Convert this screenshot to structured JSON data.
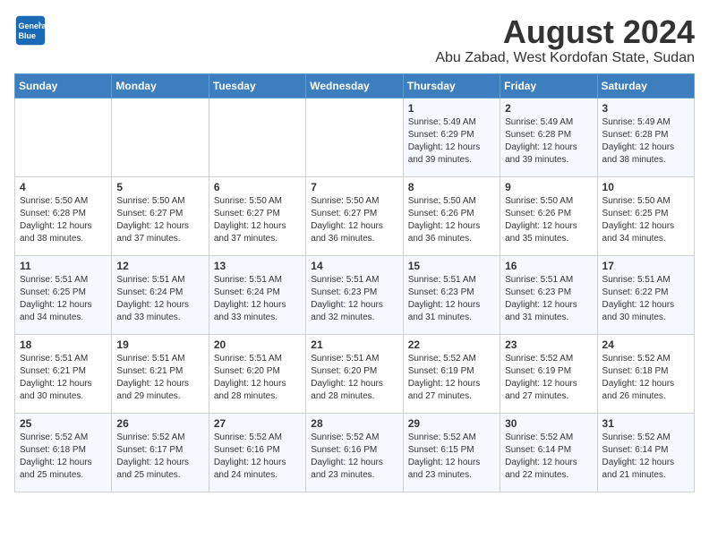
{
  "logo": {
    "line1": "General",
    "line2": "Blue"
  },
  "title": "August 2024",
  "subtitle": "Abu Zabad, West Kordofan State, Sudan",
  "days_of_week": [
    "Sunday",
    "Monday",
    "Tuesday",
    "Wednesday",
    "Thursday",
    "Friday",
    "Saturday"
  ],
  "weeks": [
    [
      {
        "day": "",
        "info": ""
      },
      {
        "day": "",
        "info": ""
      },
      {
        "day": "",
        "info": ""
      },
      {
        "day": "",
        "info": ""
      },
      {
        "day": "1",
        "info": "Sunrise: 5:49 AM\nSunset: 6:29 PM\nDaylight: 12 hours\nand 39 minutes."
      },
      {
        "day": "2",
        "info": "Sunrise: 5:49 AM\nSunset: 6:28 PM\nDaylight: 12 hours\nand 39 minutes."
      },
      {
        "day": "3",
        "info": "Sunrise: 5:49 AM\nSunset: 6:28 PM\nDaylight: 12 hours\nand 38 minutes."
      }
    ],
    [
      {
        "day": "4",
        "info": "Sunrise: 5:50 AM\nSunset: 6:28 PM\nDaylight: 12 hours\nand 38 minutes."
      },
      {
        "day": "5",
        "info": "Sunrise: 5:50 AM\nSunset: 6:27 PM\nDaylight: 12 hours\nand 37 minutes."
      },
      {
        "day": "6",
        "info": "Sunrise: 5:50 AM\nSunset: 6:27 PM\nDaylight: 12 hours\nand 37 minutes."
      },
      {
        "day": "7",
        "info": "Sunrise: 5:50 AM\nSunset: 6:27 PM\nDaylight: 12 hours\nand 36 minutes."
      },
      {
        "day": "8",
        "info": "Sunrise: 5:50 AM\nSunset: 6:26 PM\nDaylight: 12 hours\nand 36 minutes."
      },
      {
        "day": "9",
        "info": "Sunrise: 5:50 AM\nSunset: 6:26 PM\nDaylight: 12 hours\nand 35 minutes."
      },
      {
        "day": "10",
        "info": "Sunrise: 5:50 AM\nSunset: 6:25 PM\nDaylight: 12 hours\nand 34 minutes."
      }
    ],
    [
      {
        "day": "11",
        "info": "Sunrise: 5:51 AM\nSunset: 6:25 PM\nDaylight: 12 hours\nand 34 minutes."
      },
      {
        "day": "12",
        "info": "Sunrise: 5:51 AM\nSunset: 6:24 PM\nDaylight: 12 hours\nand 33 minutes."
      },
      {
        "day": "13",
        "info": "Sunrise: 5:51 AM\nSunset: 6:24 PM\nDaylight: 12 hours\nand 33 minutes."
      },
      {
        "day": "14",
        "info": "Sunrise: 5:51 AM\nSunset: 6:23 PM\nDaylight: 12 hours\nand 32 minutes."
      },
      {
        "day": "15",
        "info": "Sunrise: 5:51 AM\nSunset: 6:23 PM\nDaylight: 12 hours\nand 31 minutes."
      },
      {
        "day": "16",
        "info": "Sunrise: 5:51 AM\nSunset: 6:23 PM\nDaylight: 12 hours\nand 31 minutes."
      },
      {
        "day": "17",
        "info": "Sunrise: 5:51 AM\nSunset: 6:22 PM\nDaylight: 12 hours\nand 30 minutes."
      }
    ],
    [
      {
        "day": "18",
        "info": "Sunrise: 5:51 AM\nSunset: 6:21 PM\nDaylight: 12 hours\nand 30 minutes."
      },
      {
        "day": "19",
        "info": "Sunrise: 5:51 AM\nSunset: 6:21 PM\nDaylight: 12 hours\nand 29 minutes."
      },
      {
        "day": "20",
        "info": "Sunrise: 5:51 AM\nSunset: 6:20 PM\nDaylight: 12 hours\nand 28 minutes."
      },
      {
        "day": "21",
        "info": "Sunrise: 5:51 AM\nSunset: 6:20 PM\nDaylight: 12 hours\nand 28 minutes."
      },
      {
        "day": "22",
        "info": "Sunrise: 5:52 AM\nSunset: 6:19 PM\nDaylight: 12 hours\nand 27 minutes."
      },
      {
        "day": "23",
        "info": "Sunrise: 5:52 AM\nSunset: 6:19 PM\nDaylight: 12 hours\nand 27 minutes."
      },
      {
        "day": "24",
        "info": "Sunrise: 5:52 AM\nSunset: 6:18 PM\nDaylight: 12 hours\nand 26 minutes."
      }
    ],
    [
      {
        "day": "25",
        "info": "Sunrise: 5:52 AM\nSunset: 6:18 PM\nDaylight: 12 hours\nand 25 minutes."
      },
      {
        "day": "26",
        "info": "Sunrise: 5:52 AM\nSunset: 6:17 PM\nDaylight: 12 hours\nand 25 minutes."
      },
      {
        "day": "27",
        "info": "Sunrise: 5:52 AM\nSunset: 6:16 PM\nDaylight: 12 hours\nand 24 minutes."
      },
      {
        "day": "28",
        "info": "Sunrise: 5:52 AM\nSunset: 6:16 PM\nDaylight: 12 hours\nand 23 minutes."
      },
      {
        "day": "29",
        "info": "Sunrise: 5:52 AM\nSunset: 6:15 PM\nDaylight: 12 hours\nand 23 minutes."
      },
      {
        "day": "30",
        "info": "Sunrise: 5:52 AM\nSunset: 6:14 PM\nDaylight: 12 hours\nand 22 minutes."
      },
      {
        "day": "31",
        "info": "Sunrise: 5:52 AM\nSunset: 6:14 PM\nDaylight: 12 hours\nand 21 minutes."
      }
    ]
  ]
}
